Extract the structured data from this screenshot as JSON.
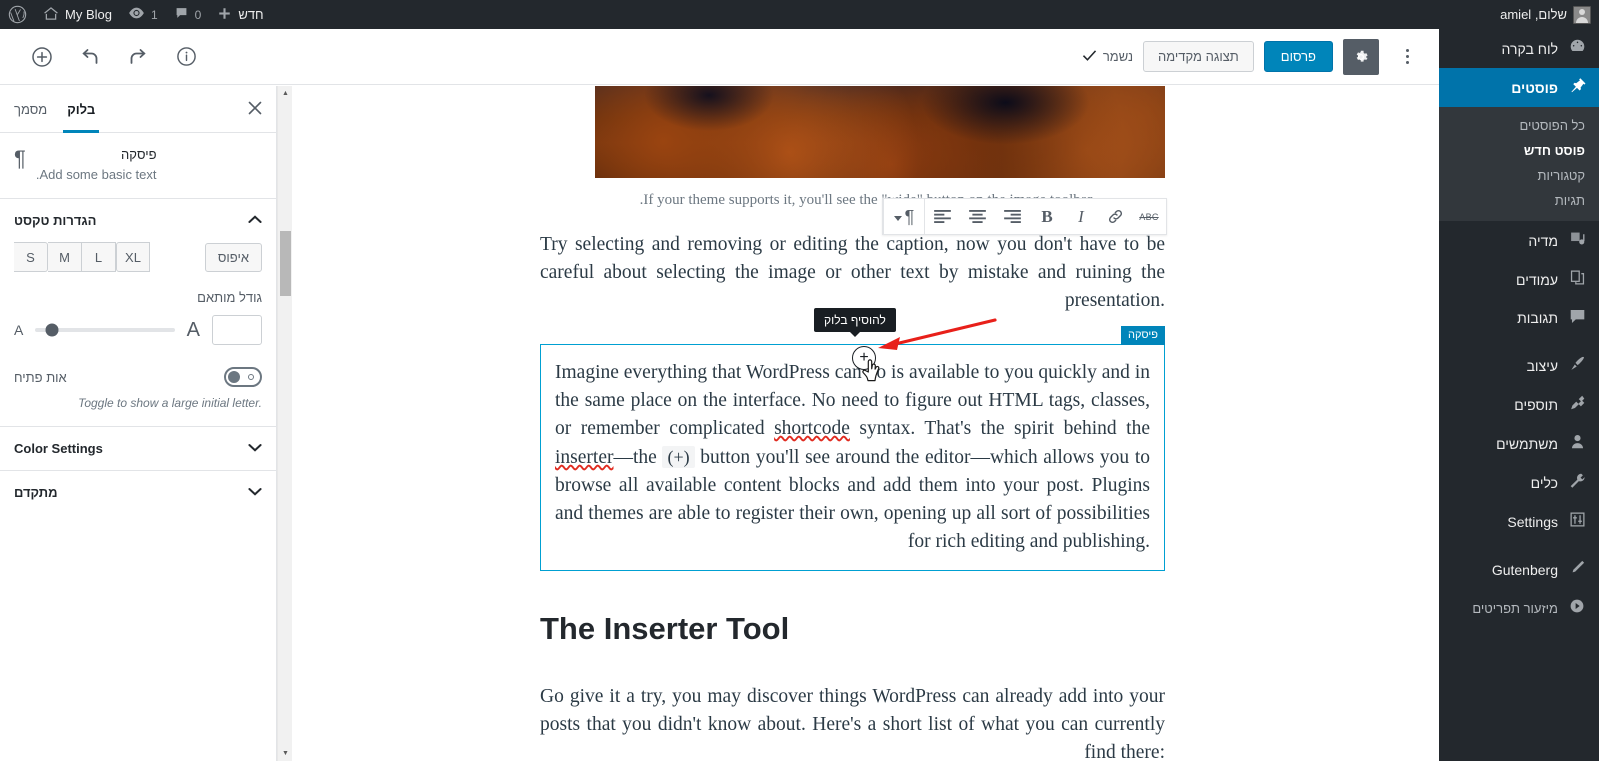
{
  "adminbar": {
    "site_greeting": "שלום, amiel",
    "new_label": "חדש",
    "comments_count": "0",
    "updates_count": "1",
    "blog_name": "My Blog",
    "wp_logo": "wordpress-logo-icon",
    "avatar": "user-avatar-icon",
    "home_icon": "home-icon",
    "updates_icon": "updates-icon",
    "comments_icon": "comment-bubble-icon",
    "plus_icon": "plus-icon"
  },
  "adminmenu": {
    "items": [
      {
        "label": "לוח בקרה",
        "icon": "dashboard-icon",
        "current": false
      },
      {
        "label": "פוסטים",
        "icon": "pin-icon",
        "current": true
      },
      {
        "label": "מדיה",
        "icon": "media-icon",
        "current": false
      },
      {
        "label": "עמודים",
        "icon": "pages-icon",
        "current": false
      },
      {
        "label": "תגובות",
        "icon": "comments-icon",
        "current": false
      },
      {
        "label": "עיצוב",
        "icon": "appearance-brush-icon",
        "current": false
      },
      {
        "label": "תוספים",
        "icon": "plugins-plug-icon",
        "current": false
      },
      {
        "label": "משתמשים",
        "icon": "users-icon",
        "current": false
      },
      {
        "label": "כלים",
        "icon": "tools-wrench-icon",
        "current": false
      },
      {
        "label": "Settings",
        "icon": "settings-sliders-icon",
        "current": false
      },
      {
        "label": "Gutenberg",
        "icon": "pencil-icon",
        "current": false
      },
      {
        "label": "מיזעור תפריטים",
        "icon": "collapse-arrow-icon",
        "current": false
      }
    ],
    "posts_submenu": [
      {
        "label": "כל הפוסטים",
        "current": false
      },
      {
        "label": "פוסט חדש",
        "current": true
      },
      {
        "label": "קטגוריות",
        "current": false
      },
      {
        "label": "תגיות",
        "current": false
      }
    ]
  },
  "editor_header": {
    "more_menu": "more-options-icon",
    "settings_gear": "gear-icon",
    "publish_label": "פרסום",
    "preview_label": "תצוגה מקדימה",
    "saved_label": "נשמר",
    "saved_check": "checkmark-icon",
    "inserter_icon": "add-block-plus-icon",
    "undo_icon": "undo-icon",
    "redo_icon": "redo-icon",
    "info_icon": "info-icon"
  },
  "settings_sidebar": {
    "tab_document": "מסמך",
    "tab_block": "בלוק",
    "active_tab": "בלוק",
    "close_icon": "close-icon",
    "block_icon": "paragraph-pilcrow-icon",
    "block_title": "פיסקה",
    "block_description": "Add some basic text.",
    "text_settings": {
      "title": "הגדרות טקסט",
      "collapsed": false,
      "size_options": [
        "S",
        "M",
        "L",
        "XL"
      ],
      "reset_label": "איפוס",
      "custom_size_label": "גודל מותאם",
      "custom_size_value": "",
      "slider_percent": 12,
      "dropcap_label": "אות פתיח",
      "dropcap_on": false,
      "dropcap_help": "Toggle to show a large initial letter."
    },
    "color_settings": {
      "title": "Color Settings",
      "collapsed": true
    },
    "advanced": {
      "title": "מתקדם",
      "collapsed": true
    }
  },
  "block_toolbar": {
    "paragraph_icon": "paragraph-type-dropdown-icon",
    "dropdown_caret": "chevron-down-icon",
    "align_right": "align-right-icon",
    "align_center": "align-center-icon",
    "align_left": "align-left-icon",
    "bold": "B",
    "italic": "I",
    "link": "link-icon",
    "strikethrough": "ABC"
  },
  "canvas": {
    "image_alt": "autumn-forest-photo",
    "caption": "If your theme supports it, you'll see the \"wide\" button on the image toolbar.",
    "paragraph_1": "Try selecting and removing or editing the caption, now you don't have to be careful about selecting the image or other text by mistake and ruining the presentation.",
    "selected_block_label": "פיסקה",
    "paragraph_2_part1": "Imagine everything that WordPress can do is available to you quickly and in the same place on the interface. No need to figure out HTML tags, classes, or remember complicated ",
    "paragraph_2_spell1": "shortcode",
    "paragraph_2_part2": " syntax. That's the spirit behind the ",
    "paragraph_2_spell2": "inserter",
    "paragraph_2_part3": "—the ",
    "paragraph_2_code": "(+)",
    "paragraph_2_part4": " button you'll see around the editor—which allows you to browse all available content blocks and add them into your post. Plugins and themes are able to register their own, opening up all sort of possibilities for rich editing and publishing.",
    "heading_2": "The Inserter Tool",
    "paragraph_3": "Go give it a try, you may discover things WordPress can already add into your posts that you didn't know about. Here's a short list of what you can currently find there:",
    "inserter_tooltip": "להוסיף בלוק",
    "inserter_plus": "+",
    "annotation_arrow": "red-pointer-arrow",
    "mouse_cursor": "pointing-hand-cursor"
  },
  "colors": {
    "admin_dark": "#23282d",
    "admin_submenu": "#32373c",
    "accent_blue": "#0073aa",
    "publish_blue": "#0085ba",
    "selection_blue": "#00a0d2",
    "spell_red": "#e02b20",
    "arrow_red": "#e8201a",
    "body_text": "#2b3a45"
  }
}
